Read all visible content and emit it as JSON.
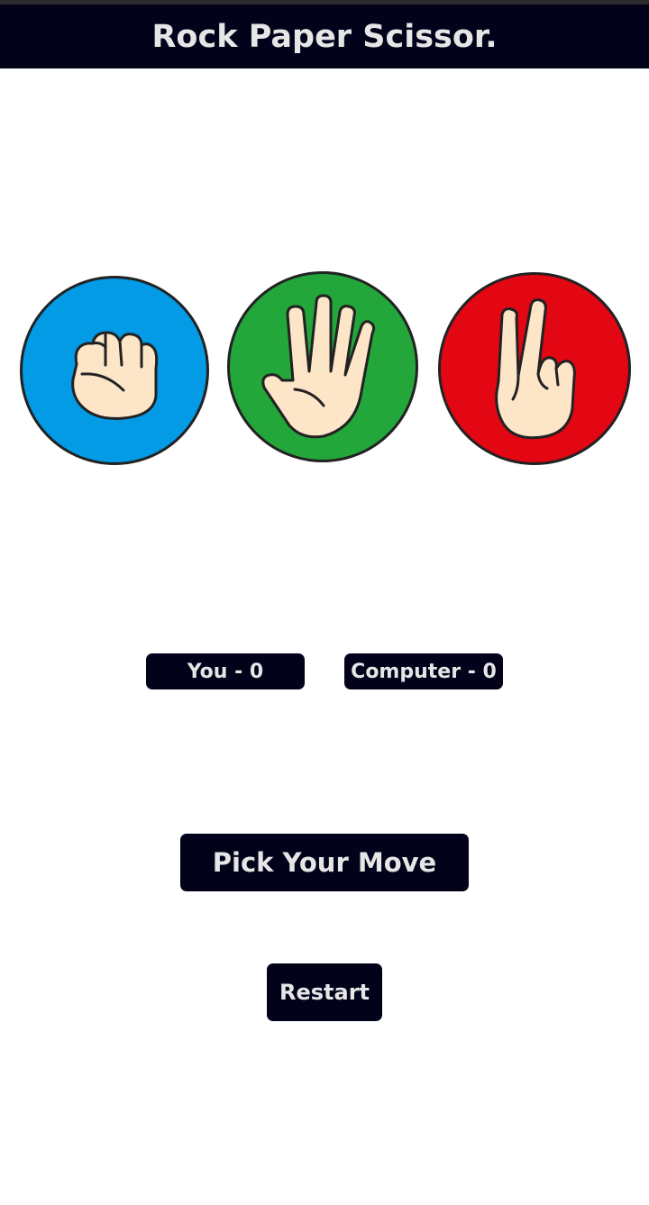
{
  "header": {
    "title": "Rock Paper Scissor."
  },
  "moves": [
    {
      "id": "rock",
      "color": "#039be5",
      "icon": "rock-fist-icon"
    },
    {
      "id": "paper",
      "color": "#23a63a",
      "icon": "paper-hand-icon"
    },
    {
      "id": "scissors",
      "color": "#e30613",
      "icon": "scissors-hand-icon"
    }
  ],
  "scores": {
    "you": "You - 0",
    "computer": "Computer - 0"
  },
  "actions": {
    "pick_label": "Pick Your Move",
    "restart_label": "Restart"
  },
  "colors": {
    "header_bg": "#02031a",
    "button_bg": "#02031a",
    "text_light": "#e6e6e6",
    "skin": "#fde5c8",
    "outline": "#222222"
  }
}
